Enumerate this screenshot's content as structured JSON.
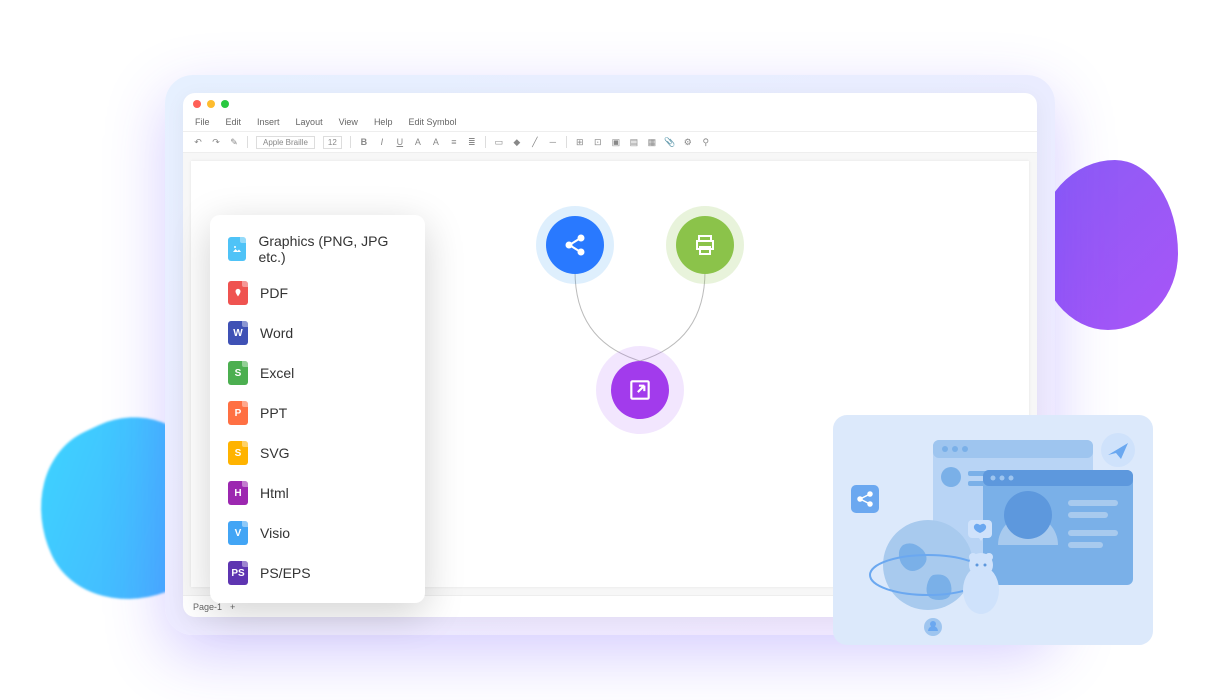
{
  "menubar": {
    "file": "File",
    "edit": "Edit",
    "insert": "Insert",
    "layout": "Layout",
    "view": "View",
    "help": "Help",
    "edit_symbol": "Edit Symbol"
  },
  "toolbar": {
    "font": "Apple Braille",
    "size": "12"
  },
  "page_tabs": {
    "page1": "Page-1",
    "add": "+"
  },
  "export_menu": [
    {
      "label": "Graphics (PNG, JPG etc.)",
      "icon": "img",
      "letter": ""
    },
    {
      "label": "PDF",
      "icon": "pdf",
      "letter": ""
    },
    {
      "label": "Word",
      "icon": "word",
      "letter": "W"
    },
    {
      "label": "Excel",
      "icon": "excel",
      "letter": "S"
    },
    {
      "label": "PPT",
      "icon": "ppt",
      "letter": "P"
    },
    {
      "label": "SVG",
      "icon": "svg",
      "letter": "S"
    },
    {
      "label": "Html",
      "icon": "html",
      "letter": "H"
    },
    {
      "label": "Visio",
      "icon": "visio",
      "letter": "V"
    },
    {
      "label": "PS/EPS",
      "icon": "ps",
      "letter": "PS"
    }
  ]
}
